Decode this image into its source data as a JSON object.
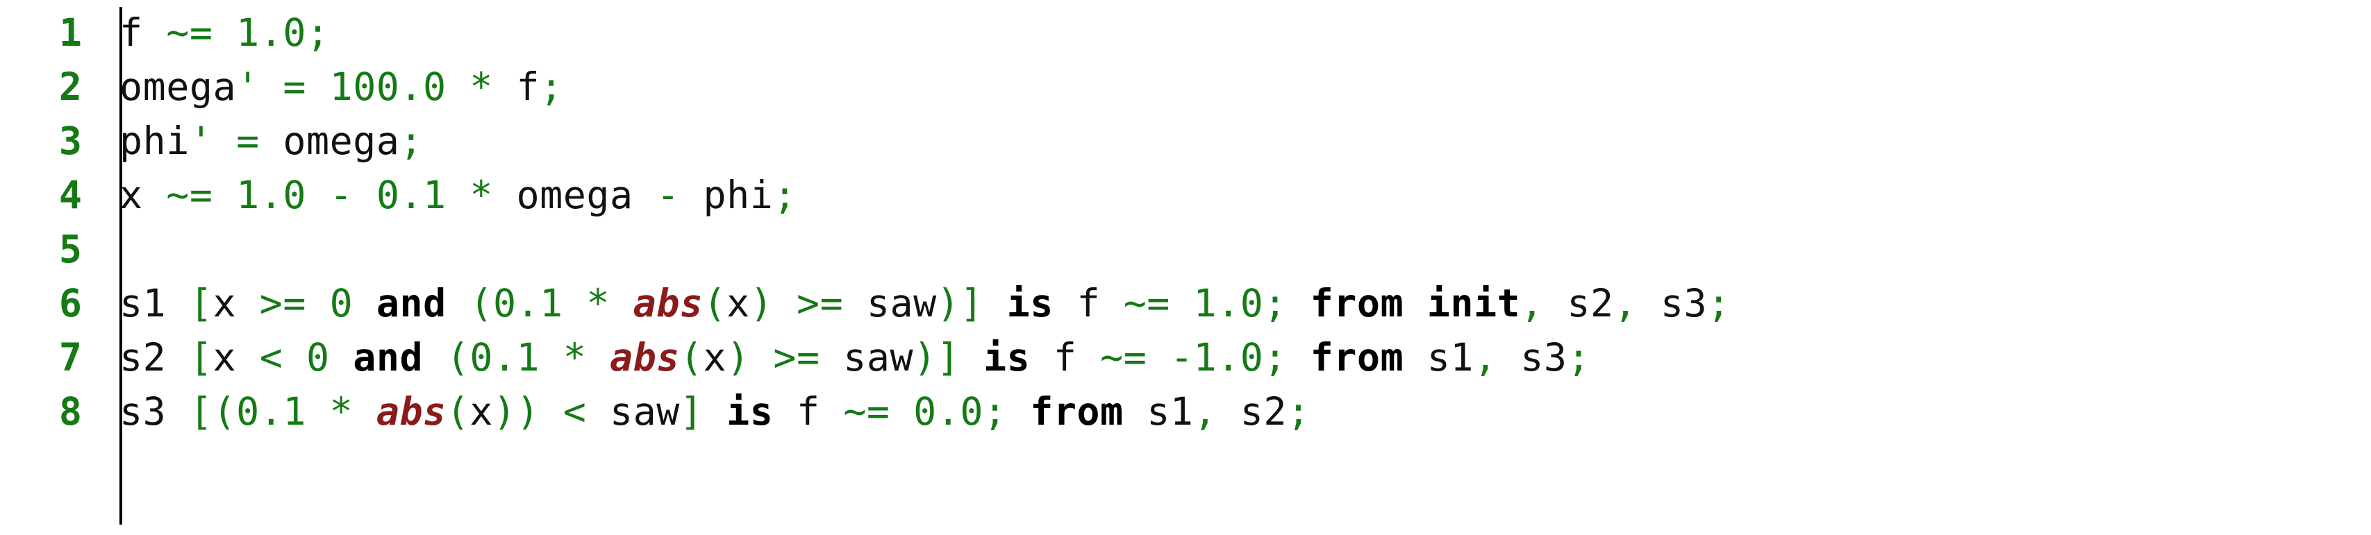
{
  "editor": {
    "kind": "code-listing",
    "language": "modelica-hybrid-automaton",
    "background_color": "#ffffff",
    "gutter_rule_color": "#000000",
    "colors": {
      "line_number": "#157a15",
      "identifier": "#111111",
      "operator": "#157a15",
      "number": "#157a15",
      "punctuation": "#157a15",
      "keyword": "#000000",
      "function": "#8b1a1a"
    }
  },
  "lines": [
    {
      "number": "1",
      "text": "f ~= 1.0;",
      "tokens": [
        {
          "t": "f",
          "k": "id"
        },
        {
          "t": " ",
          "k": "ws"
        },
        {
          "t": "~=",
          "k": "op"
        },
        {
          "t": " ",
          "k": "ws"
        },
        {
          "t": "1.0",
          "k": "num"
        },
        {
          "t": ";",
          "k": "punc"
        }
      ]
    },
    {
      "number": "2",
      "text": "omega' = 100.0 * f;",
      "tokens": [
        {
          "t": "omega",
          "k": "id"
        },
        {
          "t": "'",
          "k": "op"
        },
        {
          "t": " ",
          "k": "ws"
        },
        {
          "t": "=",
          "k": "op"
        },
        {
          "t": " ",
          "k": "ws"
        },
        {
          "t": "100.0",
          "k": "num"
        },
        {
          "t": " ",
          "k": "ws"
        },
        {
          "t": "*",
          "k": "op"
        },
        {
          "t": " ",
          "k": "ws"
        },
        {
          "t": "f",
          "k": "id"
        },
        {
          "t": ";",
          "k": "punc"
        }
      ]
    },
    {
      "number": "3",
      "text": "phi' = omega;",
      "tokens": [
        {
          "t": "phi",
          "k": "id"
        },
        {
          "t": "'",
          "k": "op"
        },
        {
          "t": " ",
          "k": "ws"
        },
        {
          "t": "=",
          "k": "op"
        },
        {
          "t": " ",
          "k": "ws"
        },
        {
          "t": "omega",
          "k": "id"
        },
        {
          "t": ";",
          "k": "punc"
        }
      ]
    },
    {
      "number": "4",
      "text": "x ~= 1.0 - 0.1 * omega - phi;",
      "tokens": [
        {
          "t": "x",
          "k": "id"
        },
        {
          "t": " ",
          "k": "ws"
        },
        {
          "t": "~=",
          "k": "op"
        },
        {
          "t": " ",
          "k": "ws"
        },
        {
          "t": "1.0",
          "k": "num"
        },
        {
          "t": " ",
          "k": "ws"
        },
        {
          "t": "-",
          "k": "op"
        },
        {
          "t": " ",
          "k": "ws"
        },
        {
          "t": "0.1",
          "k": "num"
        },
        {
          "t": " ",
          "k": "ws"
        },
        {
          "t": "*",
          "k": "op"
        },
        {
          "t": " ",
          "k": "ws"
        },
        {
          "t": "omega",
          "k": "id"
        },
        {
          "t": " ",
          "k": "ws"
        },
        {
          "t": "-",
          "k": "op"
        },
        {
          "t": " ",
          "k": "ws"
        },
        {
          "t": "phi",
          "k": "id"
        },
        {
          "t": ";",
          "k": "punc"
        }
      ]
    },
    {
      "number": "5",
      "text": "",
      "tokens": []
    },
    {
      "number": "6",
      "text": "s1 [x >= 0 and (0.1 * abs(x) >= saw)] is f ~= 1.0; from init, s2, s3;",
      "tokens": [
        {
          "t": "s1",
          "k": "id"
        },
        {
          "t": " ",
          "k": "ws"
        },
        {
          "t": "[",
          "k": "punc"
        },
        {
          "t": "x",
          "k": "id"
        },
        {
          "t": " ",
          "k": "ws"
        },
        {
          "t": ">=",
          "k": "op"
        },
        {
          "t": " ",
          "k": "ws"
        },
        {
          "t": "0",
          "k": "num"
        },
        {
          "t": " ",
          "k": "ws"
        },
        {
          "t": "and",
          "k": "kw"
        },
        {
          "t": " ",
          "k": "ws"
        },
        {
          "t": "(",
          "k": "punc"
        },
        {
          "t": "0.1",
          "k": "num"
        },
        {
          "t": " ",
          "k": "ws"
        },
        {
          "t": "*",
          "k": "op"
        },
        {
          "t": " ",
          "k": "ws"
        },
        {
          "t": "abs",
          "k": "fn"
        },
        {
          "t": "(",
          "k": "punc"
        },
        {
          "t": "x",
          "k": "id"
        },
        {
          "t": ")",
          "k": "punc"
        },
        {
          "t": " ",
          "k": "ws"
        },
        {
          "t": ">=",
          "k": "op"
        },
        {
          "t": " ",
          "k": "ws"
        },
        {
          "t": "saw",
          "k": "id"
        },
        {
          "t": ")",
          "k": "punc"
        },
        {
          "t": "]",
          "k": "punc"
        },
        {
          "t": " ",
          "k": "ws"
        },
        {
          "t": "is",
          "k": "kw"
        },
        {
          "t": " ",
          "k": "ws"
        },
        {
          "t": "f",
          "k": "id"
        },
        {
          "t": " ",
          "k": "ws"
        },
        {
          "t": "~=",
          "k": "op"
        },
        {
          "t": " ",
          "k": "ws"
        },
        {
          "t": "1.0",
          "k": "num"
        },
        {
          "t": ";",
          "k": "punc"
        },
        {
          "t": " ",
          "k": "ws"
        },
        {
          "t": "from",
          "k": "kw"
        },
        {
          "t": " ",
          "k": "ws"
        },
        {
          "t": "init",
          "k": "kw"
        },
        {
          "t": ",",
          "k": "punc"
        },
        {
          "t": " ",
          "k": "ws"
        },
        {
          "t": "s2",
          "k": "id"
        },
        {
          "t": ",",
          "k": "punc"
        },
        {
          "t": " ",
          "k": "ws"
        },
        {
          "t": "s3",
          "k": "id"
        },
        {
          "t": ";",
          "k": "punc"
        }
      ]
    },
    {
      "number": "7",
      "text": "s2 [x < 0 and (0.1 * abs(x) >= saw)] is f ~= -1.0; from s1, s3;",
      "tokens": [
        {
          "t": "s2",
          "k": "id"
        },
        {
          "t": " ",
          "k": "ws"
        },
        {
          "t": "[",
          "k": "punc"
        },
        {
          "t": "x",
          "k": "id"
        },
        {
          "t": " ",
          "k": "ws"
        },
        {
          "t": "<",
          "k": "op"
        },
        {
          "t": " ",
          "k": "ws"
        },
        {
          "t": "0",
          "k": "num"
        },
        {
          "t": " ",
          "k": "ws"
        },
        {
          "t": "and",
          "k": "kw"
        },
        {
          "t": " ",
          "k": "ws"
        },
        {
          "t": "(",
          "k": "punc"
        },
        {
          "t": "0.1",
          "k": "num"
        },
        {
          "t": " ",
          "k": "ws"
        },
        {
          "t": "*",
          "k": "op"
        },
        {
          "t": " ",
          "k": "ws"
        },
        {
          "t": "abs",
          "k": "fn"
        },
        {
          "t": "(",
          "k": "punc"
        },
        {
          "t": "x",
          "k": "id"
        },
        {
          "t": ")",
          "k": "punc"
        },
        {
          "t": " ",
          "k": "ws"
        },
        {
          "t": ">=",
          "k": "op"
        },
        {
          "t": " ",
          "k": "ws"
        },
        {
          "t": "saw",
          "k": "id"
        },
        {
          "t": ")",
          "k": "punc"
        },
        {
          "t": "]",
          "k": "punc"
        },
        {
          "t": " ",
          "k": "ws"
        },
        {
          "t": "is",
          "k": "kw"
        },
        {
          "t": " ",
          "k": "ws"
        },
        {
          "t": "f",
          "k": "id"
        },
        {
          "t": " ",
          "k": "ws"
        },
        {
          "t": "~=",
          "k": "op"
        },
        {
          "t": " ",
          "k": "ws"
        },
        {
          "t": "-1.0",
          "k": "num"
        },
        {
          "t": ";",
          "k": "punc"
        },
        {
          "t": " ",
          "k": "ws"
        },
        {
          "t": "from",
          "k": "kw"
        },
        {
          "t": " ",
          "k": "ws"
        },
        {
          "t": "s1",
          "k": "id"
        },
        {
          "t": ",",
          "k": "punc"
        },
        {
          "t": " ",
          "k": "ws"
        },
        {
          "t": "s3",
          "k": "id"
        },
        {
          "t": ";",
          "k": "punc"
        }
      ]
    },
    {
      "number": "8",
      "text": "s3 [(0.1 * abs(x)) < saw] is f ~= 0.0; from s1, s2;",
      "tokens": [
        {
          "t": "s3",
          "k": "id"
        },
        {
          "t": " ",
          "k": "ws"
        },
        {
          "t": "[",
          "k": "punc"
        },
        {
          "t": "(",
          "k": "punc"
        },
        {
          "t": "0.1",
          "k": "num"
        },
        {
          "t": " ",
          "k": "ws"
        },
        {
          "t": "*",
          "k": "op"
        },
        {
          "t": " ",
          "k": "ws"
        },
        {
          "t": "abs",
          "k": "fn"
        },
        {
          "t": "(",
          "k": "punc"
        },
        {
          "t": "x",
          "k": "id"
        },
        {
          "t": ")",
          "k": "punc"
        },
        {
          "t": ")",
          "k": "punc"
        },
        {
          "t": " ",
          "k": "ws"
        },
        {
          "t": "<",
          "k": "op"
        },
        {
          "t": " ",
          "k": "ws"
        },
        {
          "t": "saw",
          "k": "id"
        },
        {
          "t": "]",
          "k": "punc"
        },
        {
          "t": " ",
          "k": "ws"
        },
        {
          "t": "is",
          "k": "kw"
        },
        {
          "t": " ",
          "k": "ws"
        },
        {
          "t": "f",
          "k": "id"
        },
        {
          "t": " ",
          "k": "ws"
        },
        {
          "t": "~=",
          "k": "op"
        },
        {
          "t": " ",
          "k": "ws"
        },
        {
          "t": "0.0",
          "k": "num"
        },
        {
          "t": ";",
          "k": "punc"
        },
        {
          "t": " ",
          "k": "ws"
        },
        {
          "t": "from",
          "k": "kw"
        },
        {
          "t": " ",
          "k": "ws"
        },
        {
          "t": "s1",
          "k": "id"
        },
        {
          "t": ",",
          "k": "punc"
        },
        {
          "t": " ",
          "k": "ws"
        },
        {
          "t": "s2",
          "k": "id"
        },
        {
          "t": ";",
          "k": "punc"
        }
      ]
    }
  ]
}
